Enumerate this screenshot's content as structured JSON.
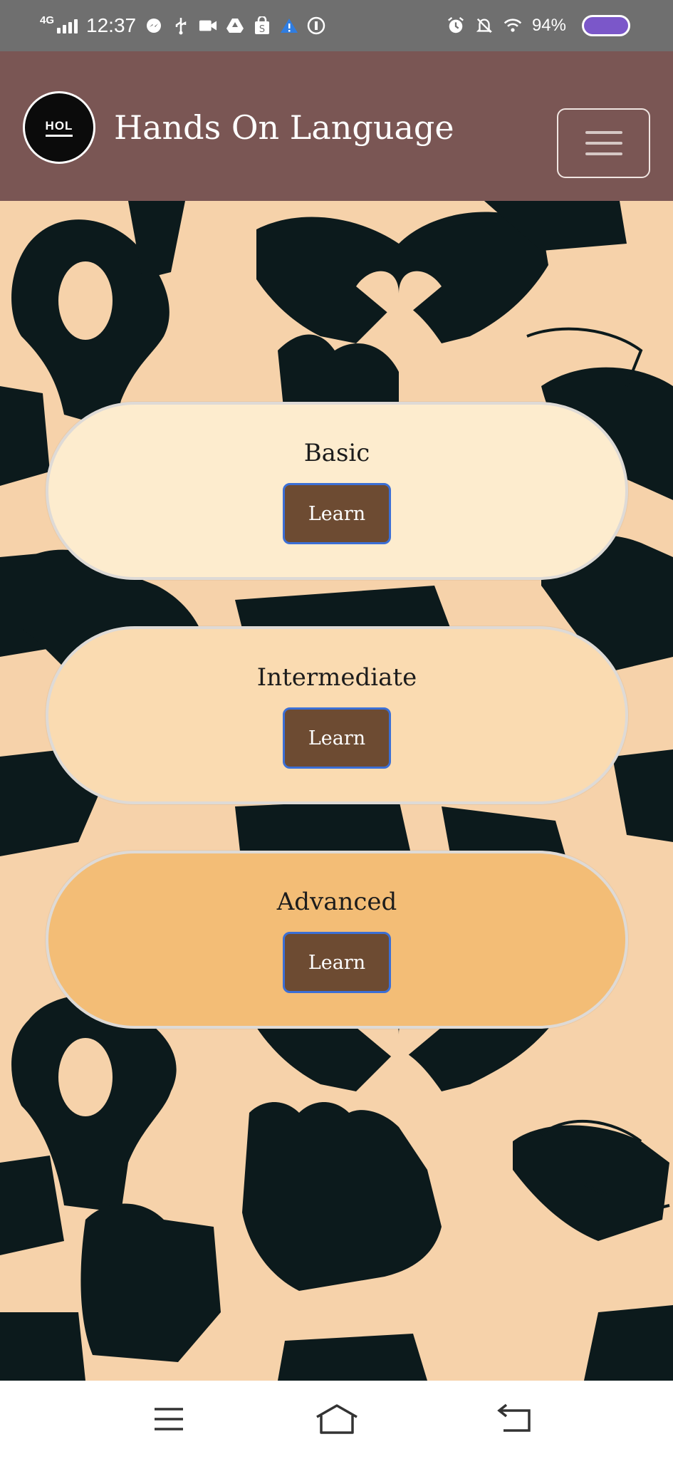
{
  "status_bar": {
    "network": "4G",
    "time": "12:37",
    "battery": "94%",
    "icons_left": [
      "messenger-icon",
      "usb-icon",
      "video-icon",
      "drive-icon",
      "shop-icon",
      "warning-icon",
      "circle-app-icon"
    ],
    "icons_right": [
      "alarm-icon",
      "silent-icon",
      "wifi-icon"
    ]
  },
  "header": {
    "logo_text": "HOL",
    "title": "Hands On Language"
  },
  "levels": [
    {
      "title": "Basic",
      "button": "Learn",
      "color": "#fdecce"
    },
    {
      "title": "Intermediate",
      "button": "Learn",
      "color": "#fadbb1"
    },
    {
      "title": "Advanced",
      "button": "Learn",
      "color": "#f3bd76"
    }
  ],
  "nav": {
    "menu": "menu-icon",
    "home": "home-icon",
    "back": "back-icon"
  },
  "colors": {
    "header_bg": "#7a5654",
    "page_bg": "#f6d2aa",
    "button_bg": "#6d4b32",
    "button_border": "#3b6fd6",
    "hand_color": "#0c1a1c"
  }
}
